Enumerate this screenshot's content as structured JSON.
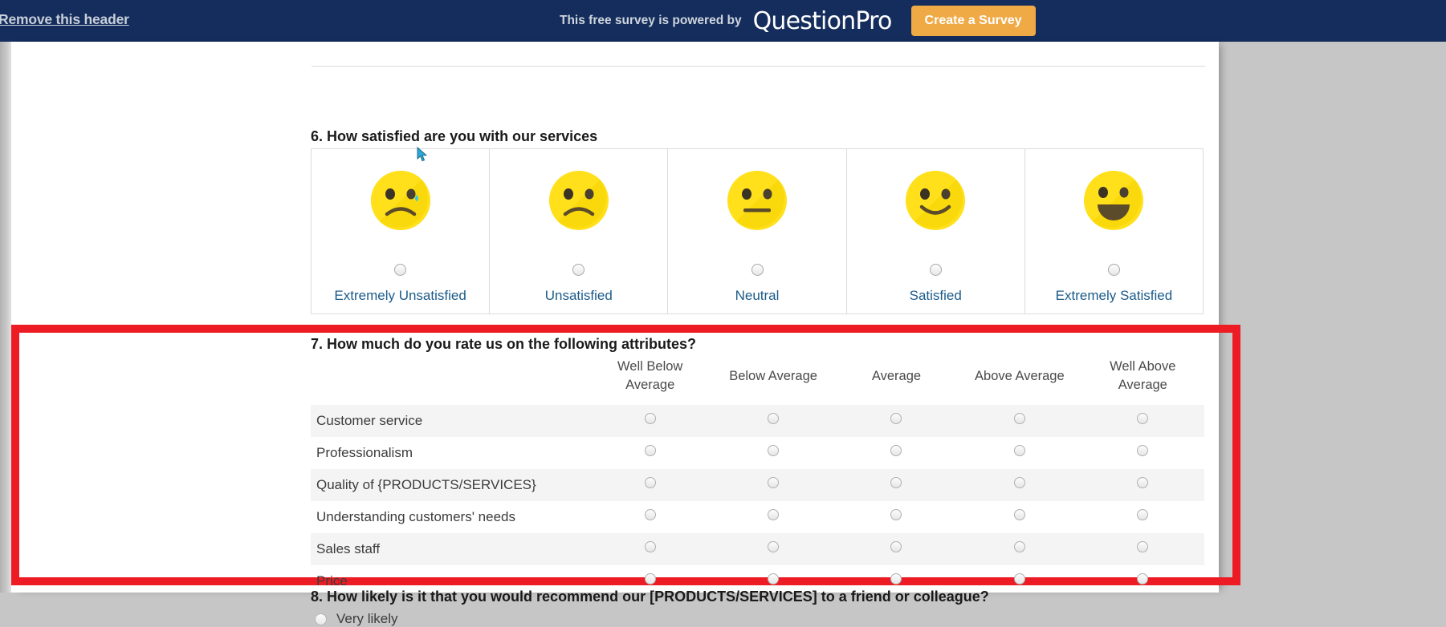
{
  "promo_header": {
    "remove_header_link": "Remove this header",
    "powered_by_text": "This free survey is powered by",
    "brand_logo_text": "QuestionPro",
    "create_survey_button": "Create a Survey",
    "background_color": "#142d5c",
    "button_color": "#efa945"
  },
  "question6": {
    "title": "6. How satisfied are you with our services",
    "options": [
      {
        "label": "Extremely Unsatisfied",
        "face": "crying-face-icon",
        "selected": false
      },
      {
        "label": "Unsatisfied",
        "face": "frowning-face-icon",
        "selected": false
      },
      {
        "label": "Neutral",
        "face": "neutral-face-icon",
        "selected": false
      },
      {
        "label": "Satisfied",
        "face": "smiling-face-icon",
        "selected": false
      },
      {
        "label": "Extremely Satisfied",
        "face": "grinning-face-icon",
        "selected": false
      }
    ],
    "label_color": "#1b5b8a"
  },
  "question7": {
    "title": "7. How much do you rate us on the following attributes?",
    "highlight_color": "#ed1c24",
    "columns": [
      "Well Below Average",
      "Below Average",
      "Average",
      "Above Average",
      "Well Above Average"
    ],
    "rows": [
      "Customer service",
      "Professionalism",
      "Quality of {PRODUCTS/SERVICES}",
      "Understanding customers' needs",
      "Sales staff",
      "Price"
    ]
  },
  "question8": {
    "title": "8. How likely is it that you would recommend our [PRODUCTS/SERVICES] to a friend or colleague?",
    "options": [
      {
        "label": "Very likely",
        "selected": false
      }
    ]
  }
}
